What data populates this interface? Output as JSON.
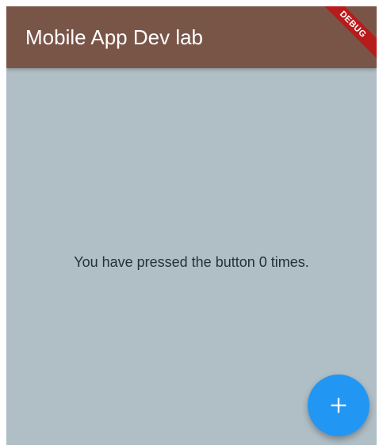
{
  "app_bar": {
    "title": "Mobile App Dev lab",
    "background_color": "#795548",
    "debug_banner": "DEBUG"
  },
  "body": {
    "background_color": "#b0bec5",
    "counter_message": "You have pressed the button 0 times."
  },
  "fab": {
    "icon": "add-icon",
    "color": "#2196f3"
  }
}
